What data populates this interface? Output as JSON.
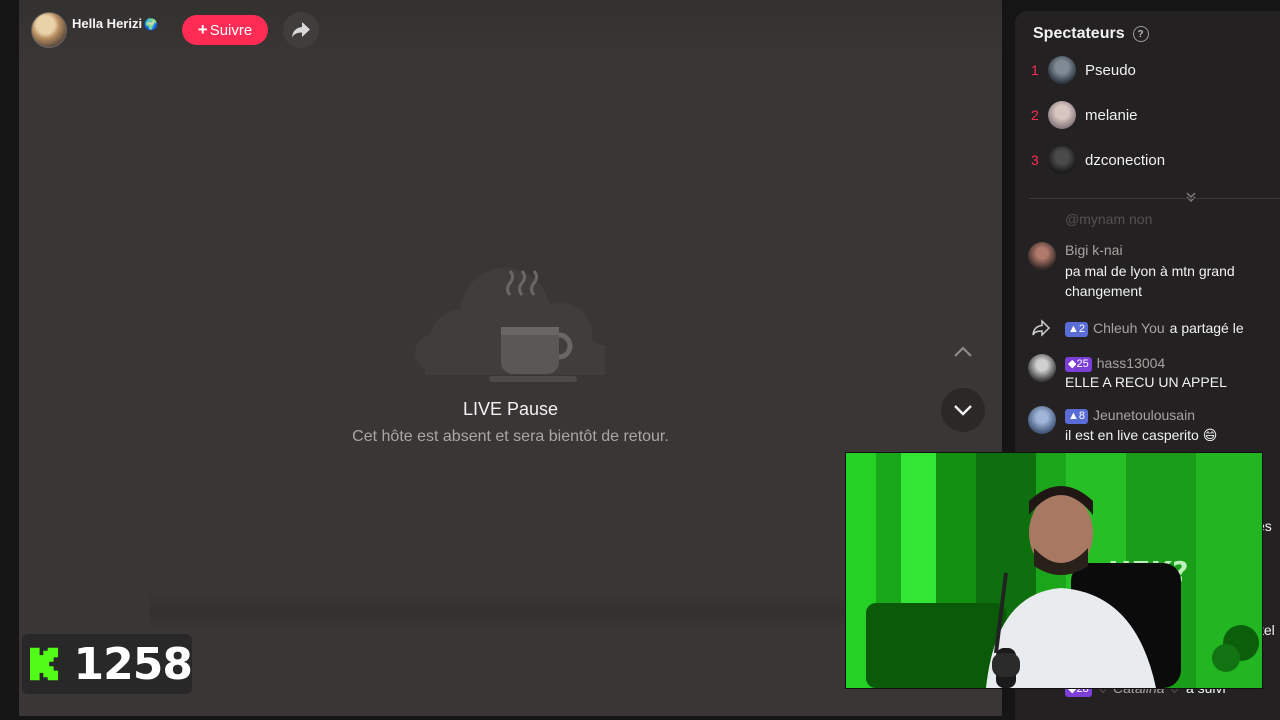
{
  "host": {
    "name": "Hella Herizi",
    "globe_icon": "🌍",
    "follow_label": "Suivre",
    "follow_plus": "+"
  },
  "pause": {
    "title": "LIVE Pause",
    "subtitle": "Cet hôte est absent et sera bientôt de retour."
  },
  "kick": {
    "count": "1258"
  },
  "sidebar": {
    "viewers_title": "Spectateurs",
    "help_icon": "?",
    "viewers": [
      {
        "rank": "1",
        "name": "Pseudo"
      },
      {
        "rank": "2",
        "name": "melanie"
      },
      {
        "rank": "3",
        "name": "dzconection"
      }
    ],
    "faded_mention": "@mynam non",
    "comments": [
      {
        "name": "Bigi k-nai",
        "text": "pa mal de lyon à mtn grand changement"
      },
      {
        "badge": "2",
        "name": "Chleuh You",
        "action": "a partagé le"
      },
      {
        "badge": "25",
        "name": "hass13004",
        "text": "ELLE A RECU UN APPEL"
      },
      {
        "badge": "8",
        "name": "Jeunetoulousain",
        "text": "il est en live casperito 😄"
      }
    ],
    "clipped": {
      "es": "es",
      "tel": "tel",
      "bottom_badge": "28",
      "bottom_name": "♡ Catalina ♡",
      "bottom_action": "a suivi"
    }
  },
  "colors": {
    "follow": "#fe2c55",
    "rank": "#fe2c55",
    "kick_green": "#53fc18",
    "live_bg": "#393635",
    "sidebar_bg": "#232121"
  }
}
